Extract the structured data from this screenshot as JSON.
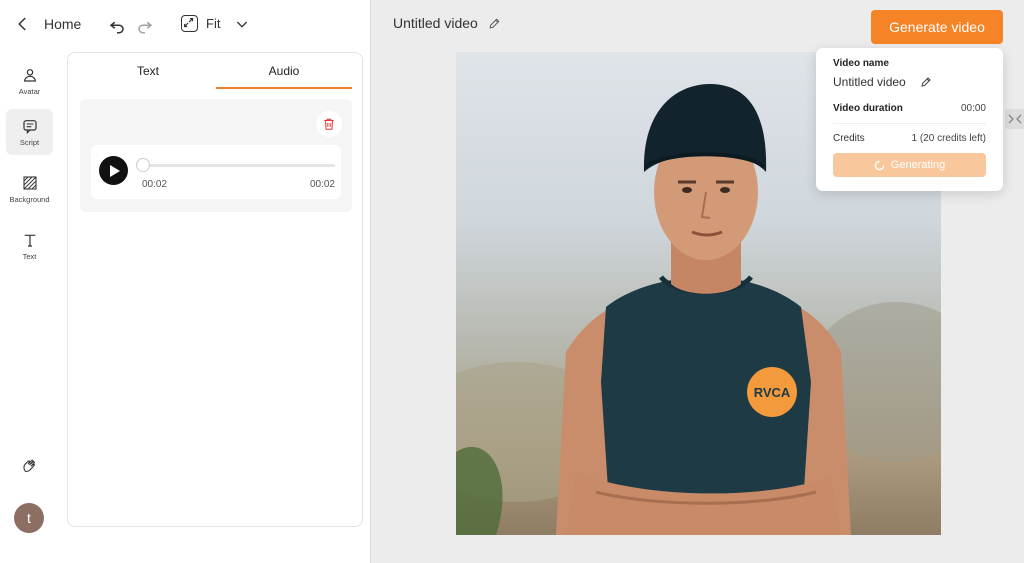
{
  "header": {
    "back_label": "Home",
    "fit_label": "Fit"
  },
  "rail": {
    "items": [
      {
        "label": "Avatar",
        "icon": "person-icon"
      },
      {
        "label": "Script",
        "icon": "script-icon"
      },
      {
        "label": "Background",
        "icon": "background-icon"
      },
      {
        "label": "Text",
        "icon": "text-icon"
      }
    ],
    "avatar_initial": "t"
  },
  "panel": {
    "tabs": [
      {
        "label": "Text"
      },
      {
        "label": "Audio"
      }
    ],
    "active_tab": "Audio",
    "audio": {
      "current_time": "00:02",
      "duration": "00:02"
    }
  },
  "canvas": {
    "video_title": "Untitled video",
    "generate_button": "Generate video"
  },
  "popover": {
    "name_label": "Video name",
    "name_value": "Untitled video",
    "duration_label": "Video duration",
    "duration_value": "00:00",
    "credits_label": "Credits",
    "credits_value": "1 (20 credits left)",
    "status_button": "Generating"
  },
  "colors": {
    "accent": "#f58426",
    "accent_light": "#f9c79c"
  }
}
